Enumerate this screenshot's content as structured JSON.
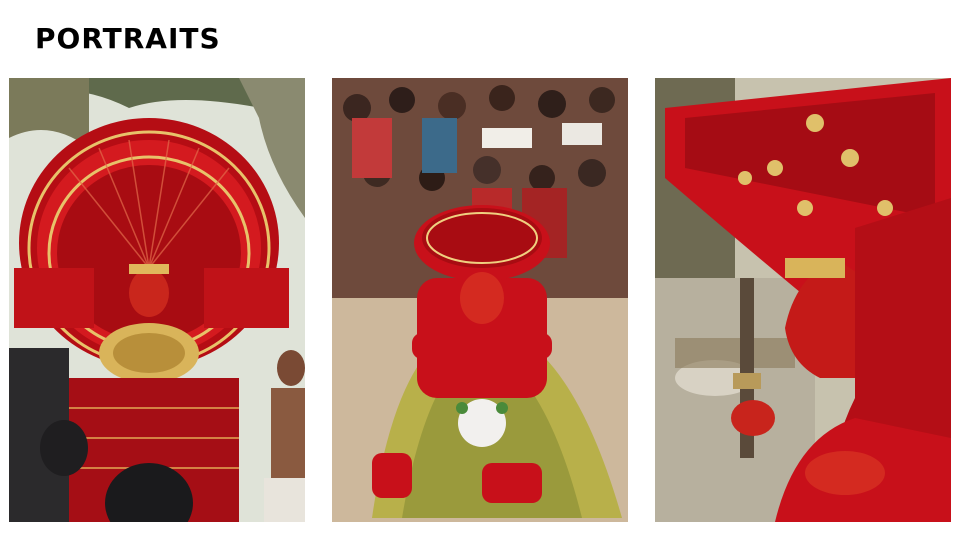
{
  "page": {
    "title": "PORTRAITS"
  },
  "photos": [
    {
      "subject": "theyyam-performer-with-large-red-headdress"
    },
    {
      "subject": "theyyam-performer-in-grass-costume-seated"
    },
    {
      "subject": "theyyam-performer-side-profile-with-sword"
    }
  ],
  "colors": {
    "title": "#000000",
    "background": "#ffffff",
    "accent_red": "#c8101a",
    "gold": "#d9b45a"
  }
}
